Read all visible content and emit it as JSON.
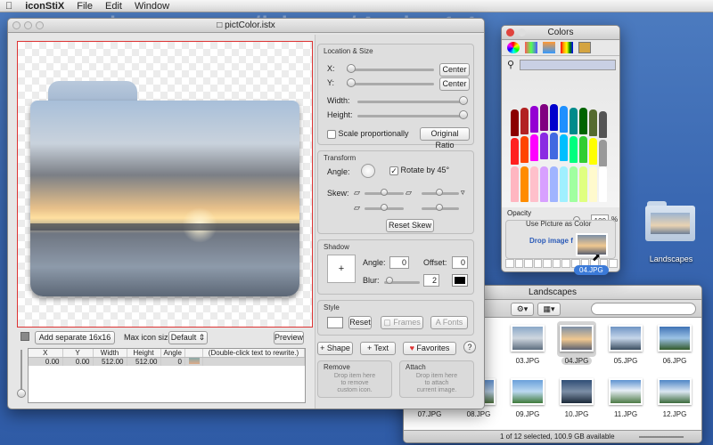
{
  "menubar": {
    "app": "iconStiX",
    "file": "File",
    "edit": "Edit",
    "window": "Window"
  },
  "watermark": "avaxhome.ws/blogs/Artist14",
  "main_window": {
    "title": "pictColor.istx",
    "add_separate": "Add separate 16x16",
    "max_icon_size_label": "Max icon size:",
    "max_icon_size_value": "Default",
    "preview": "Preview",
    "table": {
      "headers": [
        "X",
        "Y",
        "Width",
        "Height",
        "Angle",
        "",
        "(Double-click text to rewrite.)"
      ],
      "row": [
        "0.00",
        "0.00",
        "512.00",
        "512.00",
        "0"
      ]
    }
  },
  "location_size": {
    "label": "Location & Size",
    "x": "X:",
    "y": "Y:",
    "center": "Center",
    "width": "Width:",
    "height": "Height:",
    "scale": "Scale proportionally",
    "original_ratio": "Original Ratio"
  },
  "transform": {
    "label": "Transform",
    "angle": "Angle:",
    "rotate45": "Rotate by 45°",
    "skew": "Skew:",
    "reset_skew": "Reset Skew"
  },
  "shadow": {
    "label": "Shadow",
    "angle": "Angle:",
    "angle_value": "0",
    "offset": "Offset:",
    "offset_value": "0",
    "blur": "Blur:",
    "blur_value": "2"
  },
  "style": {
    "label": "Style",
    "reset": "Reset",
    "frames": "Frames",
    "fonts": "Fonts"
  },
  "actions": {
    "shape": "+ Shape",
    "text": "+ Text",
    "favorites": "Favorites",
    "help": "?"
  },
  "remove": {
    "label": "Remove",
    "hint": "Drop item here\nto remove\ncustom icon."
  },
  "attach": {
    "label": "Attach",
    "hint": "Drop item here\nto attach\ncurrent image."
  },
  "colors": {
    "title": "Colors",
    "opacity": "Opacity",
    "opacity_value": "100",
    "percent": "%",
    "use_picture": "Use Picture as Color",
    "drop_image": "Drop image f",
    "drag_label": "04.JPG"
  },
  "desktop": {
    "folder": "Landscapes"
  },
  "finder": {
    "title": "Landscapes",
    "files": [
      "03.JPG",
      "04.JPG",
      "05.JPG",
      "06.JPG",
      "07.JPG",
      "08.JPG",
      "09.JPG",
      "10.JPG",
      "11.JPG",
      "12.JPG"
    ],
    "status": "1 of 12 selected, 100.9 GB available"
  }
}
